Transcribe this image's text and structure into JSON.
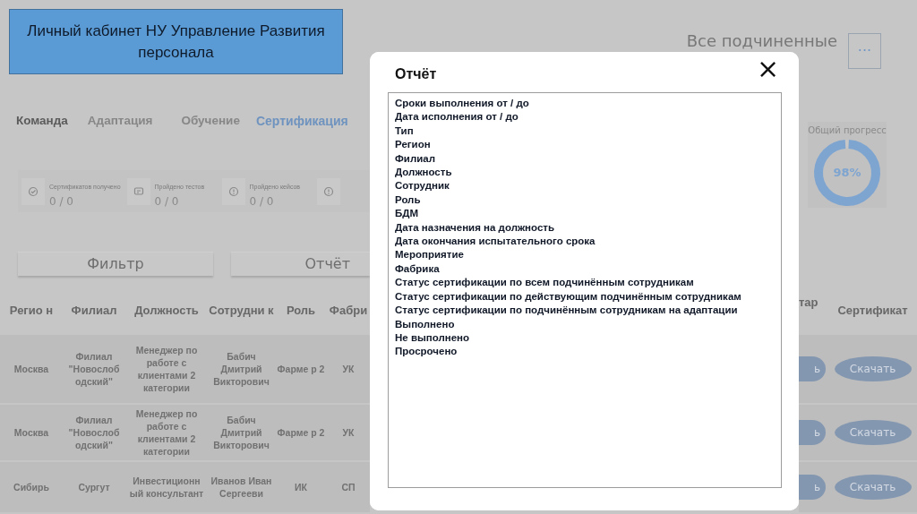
{
  "header": {
    "title": "Личный кабинет НУ Управление Развития персонала",
    "scope": "Все подчиненные",
    "menu_button": "···"
  },
  "tabs": [
    {
      "label": "Команда",
      "kind": "heading",
      "selected": false
    },
    {
      "label": "Адаптация",
      "kind": "tab",
      "selected": false
    },
    {
      "label": "Обучение",
      "kind": "tab",
      "selected": false
    },
    {
      "label": "Сертификация",
      "kind": "tab",
      "selected": true
    }
  ],
  "stats": [
    {
      "label": "Сертификатов получено",
      "value": "0 / 0",
      "kind": "check"
    },
    {
      "label": "Пройдено тестов",
      "value": "0 / 0",
      "kind": "chat"
    },
    {
      "label": "Пройдено кейсов",
      "value": "0 / 0",
      "kind": "info"
    },
    {
      "kind": "info"
    }
  ],
  "progress": {
    "title": "Общий прогресс",
    "level": 0.98,
    "reading": "98%"
  },
  "buttons": [
    "Фильтр",
    "Отчёт"
  ],
  "table": {
    "columns": [
      "Регио н",
      "Филиал",
      "Должность",
      "Сотрудни к",
      "Роль",
      "Фабри",
      "тар",
      "Сертификат"
    ],
    "rows": [
      {
        "cells": [
          "Москва",
          "Филиал \"Новослоб одский\"",
          "Менеджер по работе с клиентами 2 категории",
          "Бабич Дмитрий Викторович",
          "Фарме р 2",
          "УК"
        ],
        "actions": [
          "ь",
          "Скачать"
        ]
      },
      {
        "cells": [
          "Москва",
          "Филиал \"Новослоб одский\"",
          "Менеджер по работе с клиентами 2 категории",
          "Бабич Дмитрий Викторович",
          "Фарме р 2",
          "УК"
        ],
        "actions": [
          "ь",
          "Скачать"
        ]
      },
      {
        "cells": [
          "Сибирь",
          "Сургут",
          "Инвестиционн ый консультант",
          "Иванов Иван Сергееви",
          "ИК",
          "СП"
        ],
        "actions": [
          "ь",
          "Скачать"
        ]
      }
    ]
  },
  "modal": {
    "title": "Отчёт",
    "close": "×",
    "items": [
      "Сроки выполнения от / до",
      "Дата исполнения от / до",
      "Тип",
      "Регион",
      "Филиал",
      "Должность",
      "Сотрудник",
      "Роль",
      "БДМ",
      "Дата назначения на должность",
      "Дата окончания испытательного срока",
      "Мероприятие",
      "Фабрика",
      "Статус сертификации по всем подчинённым сотрудникам",
      "Статус сертификации по действующим подчинённым сотрудникам",
      "Статус сертификации по подчинённым сотрудникам на адаптации",
      "Выполнено",
      "Не выполнено",
      "Просрочено"
    ]
  }
}
